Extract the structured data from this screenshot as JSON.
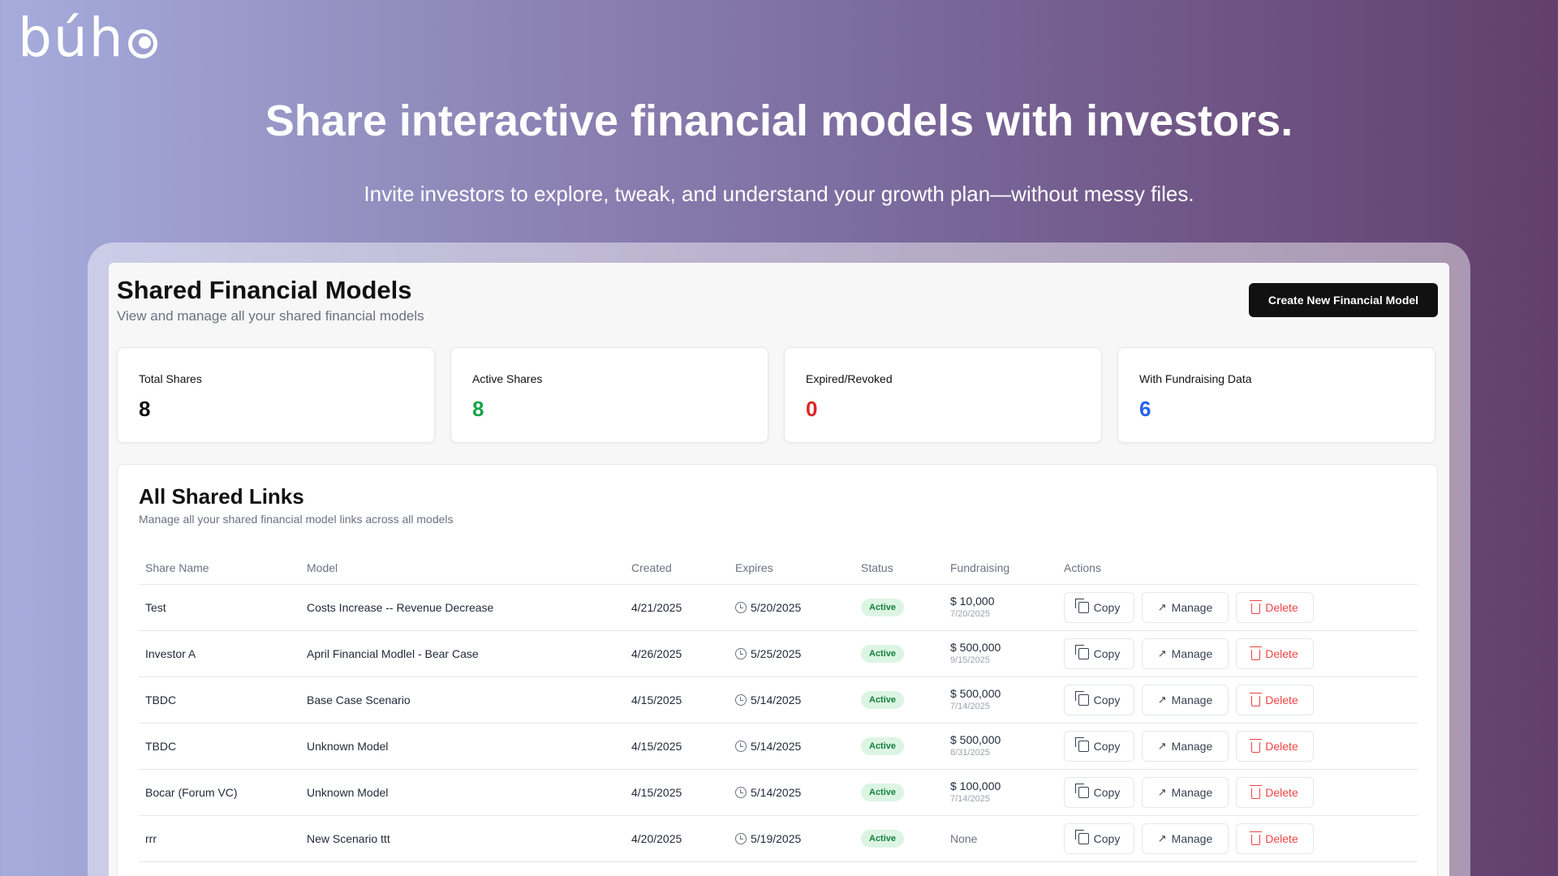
{
  "brand": {
    "logo_text": "búh"
  },
  "hero": {
    "title": "Share interactive financial models with investors.",
    "subtitle": "Invite investors to explore, tweak, and understand your growth plan—without messy files."
  },
  "page": {
    "title": "Shared Financial Models",
    "subtitle": "View and manage all your shared financial models",
    "create_button": "Create New Financial Model"
  },
  "stats": [
    {
      "label": "Total Shares",
      "value": "8",
      "color": "#111111"
    },
    {
      "label": "Active Shares",
      "value": "8",
      "color": "#16a34a"
    },
    {
      "label": "Expired/Revoked",
      "value": "0",
      "color": "#dc2626"
    },
    {
      "label": "With Fundraising Data",
      "value": "6",
      "color": "#2563eb"
    }
  ],
  "links": {
    "title": "All Shared Links",
    "subtitle": "Manage all your shared financial model links across all models",
    "columns": {
      "name": "Share Name",
      "model": "Model",
      "created": "Created",
      "expires": "Expires",
      "status": "Status",
      "fundraising": "Fundraising",
      "actions": "Actions"
    },
    "actions": {
      "copy": "Copy",
      "manage": "Manage",
      "delete": "Delete"
    },
    "rows": [
      {
        "name": "Test",
        "model": "Costs Increase -- Revenue Decrease",
        "created": "4/21/2025",
        "expires": "5/20/2025",
        "status": "Active",
        "amount": "$ 10,000",
        "fund_date": "7/20/2025"
      },
      {
        "name": "Investor A",
        "model": "April Financial Modlel - Bear Case",
        "created": "4/26/2025",
        "expires": "5/25/2025",
        "status": "Active",
        "amount": "$ 500,000",
        "fund_date": "9/15/2025"
      },
      {
        "name": "TBDC",
        "model": "Base Case Scenario",
        "created": "4/15/2025",
        "expires": "5/14/2025",
        "status": "Active",
        "amount": "$ 500,000",
        "fund_date": "7/14/2025"
      },
      {
        "name": "TBDC",
        "model": "Unknown Model",
        "created": "4/15/2025",
        "expires": "5/14/2025",
        "status": "Active",
        "amount": "$ 500,000",
        "fund_date": "8/31/2025"
      },
      {
        "name": "Bocar (Forum VC)",
        "model": "Unknown Model",
        "created": "4/15/2025",
        "expires": "5/14/2025",
        "status": "Active",
        "amount": "$ 100,000",
        "fund_date": "7/14/2025"
      },
      {
        "name": "rrr",
        "model": "New Scenario ttt",
        "created": "4/20/2025",
        "expires": "5/19/2025",
        "status": "Active",
        "amount": "None",
        "fund_date": ""
      }
    ]
  }
}
